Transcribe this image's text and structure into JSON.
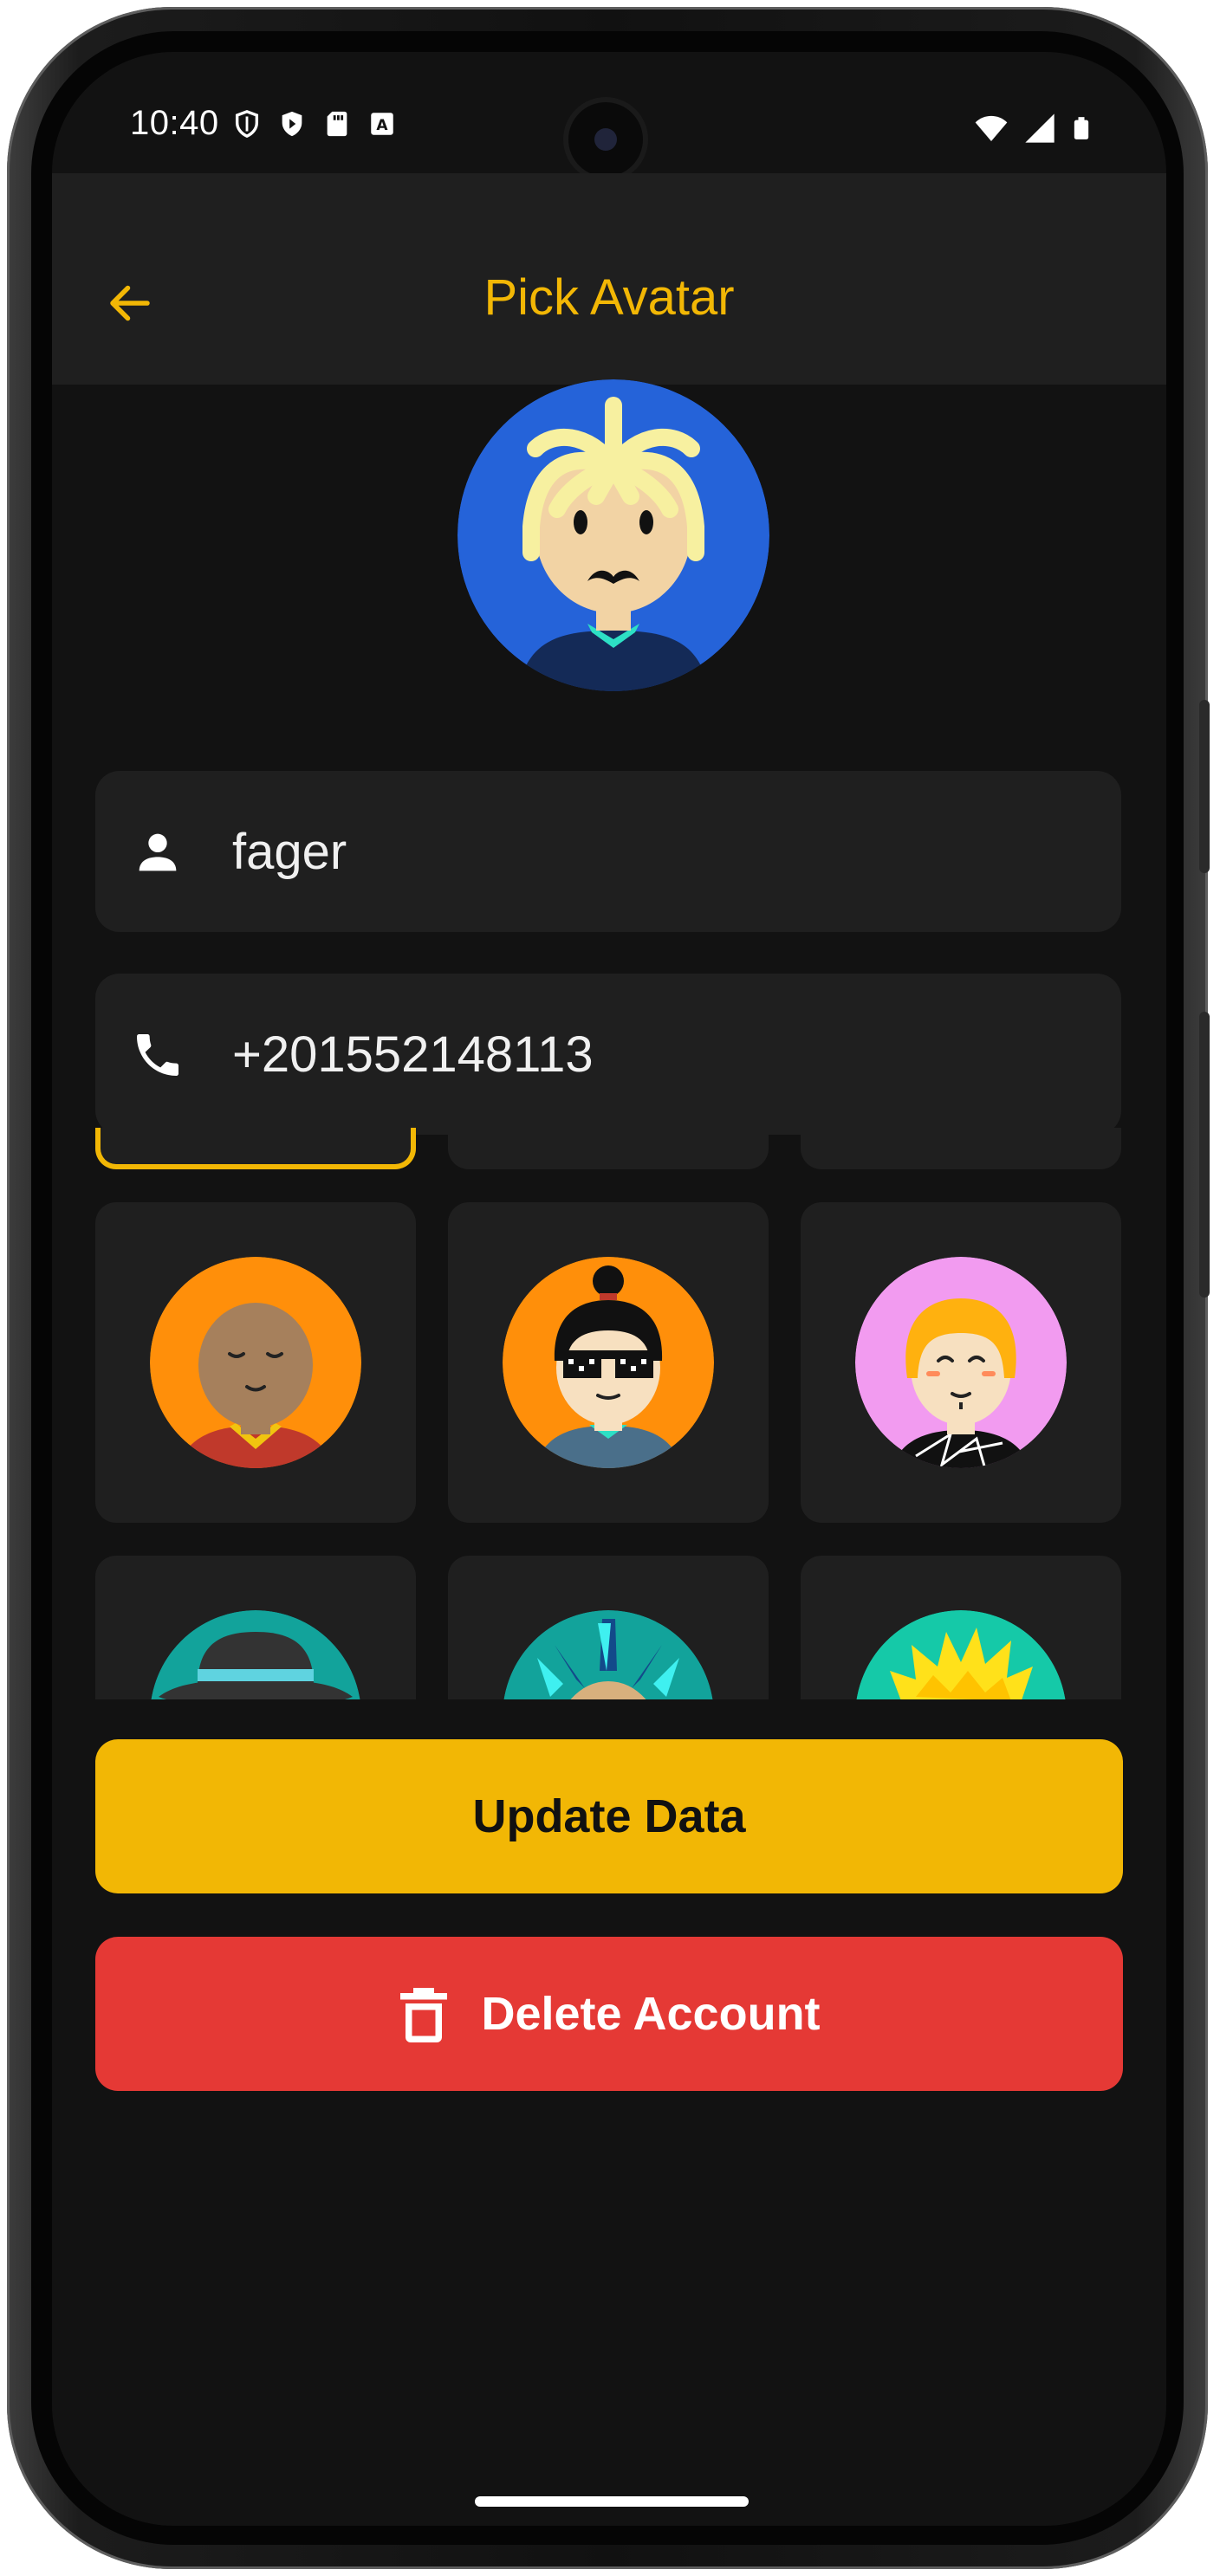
{
  "status_bar": {
    "time": "10:40",
    "left_icons": [
      "shield-icon",
      "play-protect-icon",
      "sd-card-icon",
      "keyboard-a-icon"
    ],
    "right_icons": [
      "wifi-icon",
      "signal-icon",
      "battery-icon"
    ]
  },
  "app_bar": {
    "title": "Pick Avatar",
    "back_icon": "arrow-left-icon"
  },
  "colors": {
    "accent": "#f2b705",
    "background": "#121212",
    "surface": "#1f1f1f",
    "danger": "#e53935"
  },
  "form": {
    "name": {
      "icon": "person-icon",
      "value": "fager"
    },
    "phone": {
      "icon": "phone-icon",
      "value": "+201552148113"
    }
  },
  "avatar_grid": {
    "selected_index": 0,
    "items": [
      "avatar-1",
      "avatar-2",
      "avatar-3",
      "avatar-orange-sleepy",
      "avatar-glasses-bun",
      "avatar-pink-blonde",
      "avatar-teal-hat",
      "avatar-teal-mohawk",
      "avatar-teal-yellow-hair"
    ]
  },
  "buttons": {
    "update_label": "Update Data",
    "delete_label": "Delete Account",
    "delete_icon": "trash-icon"
  }
}
